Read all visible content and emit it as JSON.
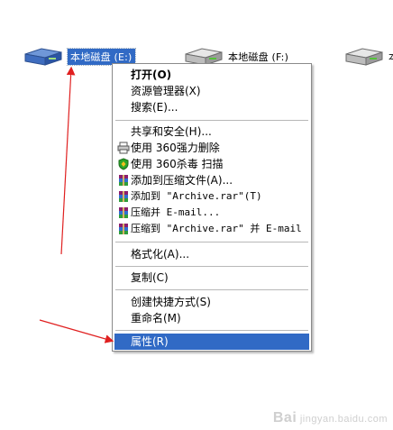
{
  "drives": [
    {
      "label": "本地磁盘 (E:)",
      "selected": true
    },
    {
      "label": "本地磁盘 (F:)",
      "selected": false
    },
    {
      "label": "本",
      "selected": false
    }
  ],
  "menu": {
    "items": [
      {
        "label": "打开(O)",
        "icon": "",
        "bold": true
      },
      {
        "label": "资源管理器(X)",
        "icon": ""
      },
      {
        "label": "搜索(E)...",
        "icon": ""
      },
      {
        "label": "共享和安全(H)...",
        "icon": ""
      },
      {
        "label": "使用 360强力删除",
        "icon": "printer-icon"
      },
      {
        "label": "使用 360杀毒 扫描",
        "icon": "shield-icon"
      },
      {
        "label": "添加到压缩文件(A)...",
        "icon": "winrar-icon"
      },
      {
        "label": "添加到 \"Archive.rar\"(T)",
        "icon": "winrar-icon"
      },
      {
        "label": "压缩并 E-mail...",
        "icon": "winrar-icon"
      },
      {
        "label": "压缩到 \"Archive.rar\" 并 E-mail",
        "icon": "winrar-icon"
      },
      {
        "label": "格式化(A)...",
        "icon": ""
      },
      {
        "label": "复制(C)",
        "icon": ""
      },
      {
        "label": "创建快捷方式(S)",
        "icon": ""
      },
      {
        "label": "重命名(M)",
        "icon": ""
      },
      {
        "label": "属性(R)",
        "icon": "",
        "active": true
      }
    ]
  },
  "annotations": {
    "arrow_color": "#e02020"
  },
  "watermark": {
    "brand": "Bai",
    "suffix": "jingyan.baidu.com"
  }
}
